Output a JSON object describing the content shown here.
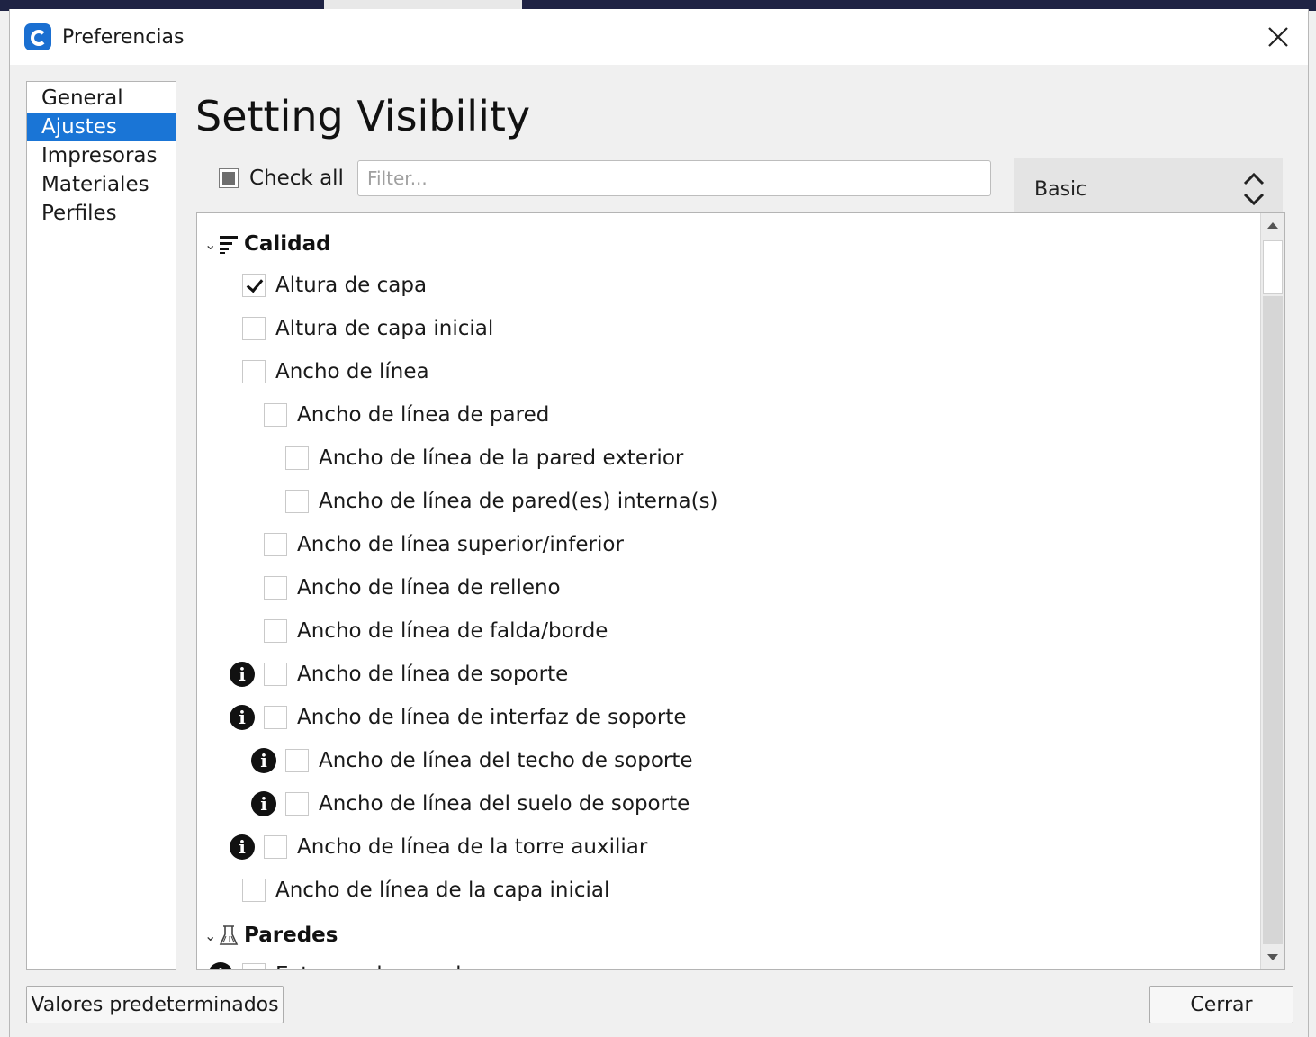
{
  "window": {
    "title": "Preferencias"
  },
  "nav": {
    "items": [
      "General",
      "Ajustes",
      "Impresoras",
      "Materiales",
      "Perfiles"
    ],
    "selected": "Ajustes"
  },
  "heading": "Setting Visibility",
  "check_all": {
    "label": "Check all"
  },
  "filter": {
    "placeholder": "Filter...",
    "value": ""
  },
  "preset": {
    "value": "Basic"
  },
  "categories": [
    {
      "label": "Calidad",
      "icon": "quality-icon"
    },
    {
      "label": "Paredes",
      "icon": "walls-icon"
    }
  ],
  "settings": [
    {
      "label": "Altura de capa",
      "checked": true,
      "info": false
    },
    {
      "label": "Altura de capa inicial",
      "checked": false,
      "info": false
    },
    {
      "label": "Ancho de línea",
      "checked": false,
      "info": false
    },
    {
      "label": "Ancho de línea de pared",
      "checked": false,
      "info": false
    },
    {
      "label": "Ancho de línea de la pared exterior",
      "checked": false,
      "info": false
    },
    {
      "label": "Ancho de línea de pared(es) interna(s)",
      "checked": false,
      "info": false
    },
    {
      "label": "Ancho de línea superior/inferior",
      "checked": false,
      "info": false
    },
    {
      "label": "Ancho de línea de relleno",
      "checked": false,
      "info": false
    },
    {
      "label": "Ancho de línea de falda/borde",
      "checked": false,
      "info": false
    },
    {
      "label": "Ancho de línea de soporte",
      "checked": false,
      "info": true
    },
    {
      "label": "Ancho de línea de interfaz de soporte",
      "checked": false,
      "info": true
    },
    {
      "label": "Ancho de línea del techo de soporte",
      "checked": false,
      "info": true
    },
    {
      "label": "Ancho de línea del suelo de soporte",
      "checked": false,
      "info": true
    },
    {
      "label": "Ancho de línea de la torre auxiliar",
      "checked": false,
      "info": true
    },
    {
      "label": "Ancho de línea de la capa inicial",
      "checked": false,
      "info": false
    },
    {
      "label": "Extrusor de pared",
      "checked": false,
      "info": true
    }
  ],
  "buttons": {
    "defaults": "Valores predeterminados",
    "close": "Cerrar"
  }
}
